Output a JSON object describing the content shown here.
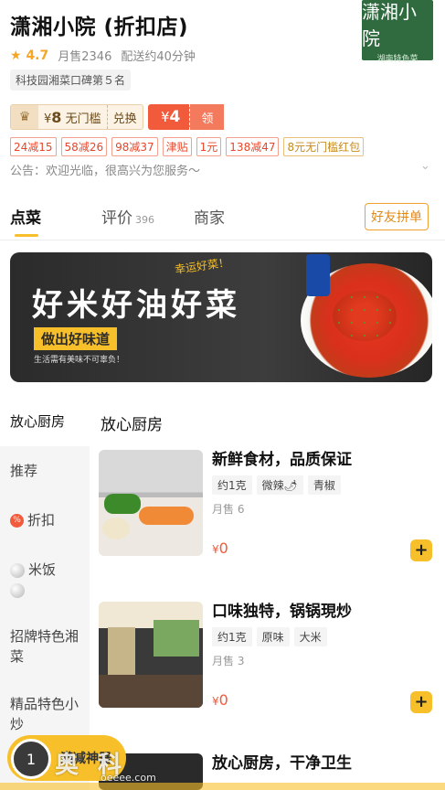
{
  "shop": {
    "name": "潇湘小院 (折扣店)",
    "rating": "4.7",
    "monthly_sales": "月售2346",
    "delivery": "配送约40分钟",
    "rank": "科技园湘菜口碑第５名",
    "logo_text": "潇湘小院",
    "logo_sub": "湖南特色菜"
  },
  "vip": {
    "currency": "¥",
    "amount": "8",
    "label": "无门槛",
    "exchange": "兑换"
  },
  "coupon": {
    "currency": "¥",
    "amount": "4",
    "get": "领"
  },
  "promos": [
    "24减15",
    "58减26",
    "98减37",
    "津贴",
    "1元",
    "138减47",
    "8元无门槛红包"
  ],
  "notice": "公告：欢迎光临，很高兴为您服务～",
  "tabs": {
    "order": "点菜",
    "reviews": "评价",
    "reviews_count": "396",
    "merchant": "商家",
    "group": "好友拼单"
  },
  "banner": {
    "title": "好米好油好菜",
    "subtitle": "做出好味道",
    "small": "生活需有美味不可辜负！",
    "tagline": "幸运好菜！"
  },
  "menu": {
    "sidebar_header": "放心厨房",
    "section_header": "放心厨房",
    "categories": [
      "推荐",
      "折扣",
      "米饭",
      "招牌特色湘菜",
      "精品特色小炒"
    ]
  },
  "dishes": [
    {
      "name": "新鲜食材，品质保证",
      "tags": [
        "约1克",
        "微辣🌶",
        "青椒"
      ],
      "sold": "月售 6",
      "currency": "¥",
      "price": "0"
    },
    {
      "name": "口味独特，锅锅現炒",
      "tags": [
        "约1克",
        "原味",
        "大米"
      ],
      "sold": "月售 3",
      "currency": "¥",
      "price": "0"
    },
    {
      "name": "放心厨房，干净卫生",
      "tags": [],
      "sold": "",
      "currency": "¥",
      "price": ""
    }
  ],
  "cart": {
    "label": "满减神器",
    "count": "1"
  },
  "watermark": {
    "text": "奥 科",
    "url": "oeeee.com"
  },
  "colors": {
    "accent": "#f7c02a",
    "red": "#f25a3c",
    "logo_bg": "#2f6b3e"
  }
}
